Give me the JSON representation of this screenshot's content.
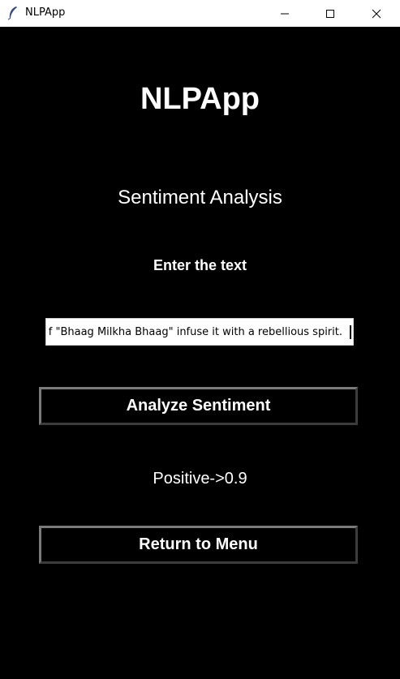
{
  "window": {
    "title": "NLPApp",
    "icon": "feather-icon",
    "controls": [
      "minimize-icon",
      "maximize-icon",
      "close-icon"
    ]
  },
  "main": {
    "app_heading": "NLPApp",
    "section_heading": "Sentiment Analysis",
    "input_label": "Enter the text",
    "input_value": "f \"Bhaag Milkha Bhaag\" infuse it with a rebellious spirit.",
    "analyze_button_label": "Analyze Sentiment",
    "result_text": "Positive->0.9",
    "return_button_label": "Return to Menu"
  },
  "colors": {
    "background": "#000000",
    "text": "#ffffff",
    "titlebar": "#ffffff",
    "button_border_light": "#7a7a7a",
    "button_border_dark": "#3c3c3c"
  }
}
